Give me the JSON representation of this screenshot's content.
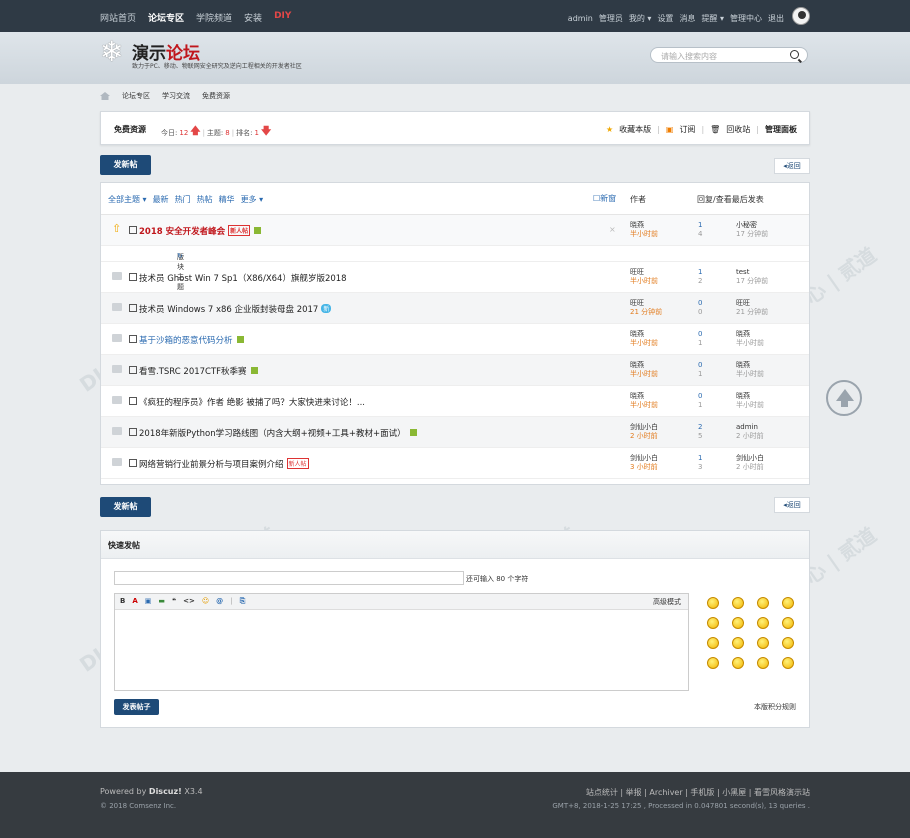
{
  "topnav": {
    "items": [
      "网站首页",
      "论坛专区",
      "学院频道",
      "安装",
      "DIY"
    ],
    "user_items": [
      "admin",
      "管理员",
      "我的 ▾",
      "设置",
      "消息",
      "提醒 ▾",
      "管理中心",
      "退出"
    ]
  },
  "header": {
    "logo_title_a": "演示",
    "logo_title_b": "论坛",
    "logo_subtitle": "致力于PC、移动、物联网安全研究及逆向工程相关的开发者社区",
    "search_placeholder": "请输入搜索内容"
  },
  "breadcrumb": [
    "论坛专区",
    "学习交流",
    "免费资源"
  ],
  "forum": {
    "name": "免费资源",
    "today_label": "今日:",
    "today": "12",
    "topics_label": "主题:",
    "topics": "8",
    "rank_label": "排名:",
    "rank": "1",
    "actions": [
      "收藏本版",
      "订阅",
      "回收站",
      "管理面板"
    ]
  },
  "buttons": {
    "new_post": "发新帖",
    "back": "◂返回",
    "submit": "发表帖子"
  },
  "threadlist": {
    "filters": [
      "全部主题 ▾",
      "最新",
      "热门",
      "热帖",
      "精华",
      "更多 ▾"
    ],
    "new_label": "新窗",
    "col_author": "作者",
    "col_reply": "回复/查看",
    "col_last": "最后发表",
    "section_label": "版块主题",
    "threads": [
      {
        "title": "2018 安全开发者峰会",
        "style": "red",
        "tag": "新人帖",
        "img": true,
        "author": "晓燕",
        "atime": "半小时前",
        "replies": "1",
        "views": "4",
        "last": "小秘密",
        "ltime": "17 分钟前"
      },
      {
        "title": "技术员 Ghost Win 7 Sp1（X86/X64）旗舰岁版2018",
        "style": "",
        "tag": "",
        "img": false,
        "author": "旺旺",
        "atime": "半小时前",
        "replies": "1",
        "views": "2",
        "last": "test",
        "ltime": "17 分钟前"
      },
      {
        "title": "技术员 Windows 7 x86 企业版封装母盘 2017",
        "style": "",
        "tag": "新",
        "img": false,
        "author": "旺旺",
        "atime": "21 分钟前",
        "replies": "0",
        "views": "0",
        "last": "旺旺",
        "ltime": "21 分钟前"
      },
      {
        "title": "基于沙箱的恶意代码分析",
        "style": "blue",
        "tag": "",
        "img": true,
        "author": "晓燕",
        "atime": "半小时前",
        "replies": "0",
        "views": "1",
        "last": "晓燕",
        "ltime": "半小时前"
      },
      {
        "title": "看雪.TSRC 2017CTF秋季赛",
        "style": "",
        "tag": "",
        "img": true,
        "author": "晓燕",
        "atime": "半小时前",
        "replies": "0",
        "views": "1",
        "last": "晓燕",
        "ltime": "半小时前"
      },
      {
        "title": "《疯狂的程序员》作者 绝影 被捕了吗？大家快进来讨论！...",
        "style": "",
        "tag": "",
        "img": false,
        "author": "晓燕",
        "atime": "半小时前",
        "replies": "0",
        "views": "1",
        "last": "晓燕",
        "ltime": "半小时前"
      },
      {
        "title": "2018年新版Python学习路线图（内含大纲+视频+工具+教材+面试）",
        "style": "",
        "tag": "",
        "img": true,
        "author": "剑仙小白",
        "atime": "2 小时前",
        "replies": "2",
        "views": "5",
        "last": "admin",
        "ltime": "2 小时前"
      },
      {
        "title": "网络营销行业前景分析与项目案例介绍",
        "style": "",
        "tag": "新人帖",
        "img": false,
        "author": "剑仙小白",
        "atime": "3 小时前",
        "replies": "1",
        "views": "3",
        "last": "剑仙小白",
        "ltime": "2 小时前"
      }
    ]
  },
  "quickpost": {
    "title": "快速发帖",
    "subject_hint": "还可输入 80 个字符",
    "toolbar": [
      "B",
      "A",
      "▣",
      "▬",
      "❝",
      "<>",
      "☺",
      "@",
      "|",
      "⎘"
    ],
    "advanced": "高级模式",
    "rules": "本版积分规则"
  },
  "watermark": "DISCUZ!应用中心 | 贰道",
  "watermark2": "addon.dismall.com",
  "footer": {
    "powered_prefix": "Powered by ",
    "powered_name": "Discuz!",
    "powered_version": " X3.4",
    "copyright": "© 2018 Comsenz Inc.",
    "links": "站点统计 | 举报 | Archiver | 手机版 | 小黑屋 | 看雪风格演示站",
    "stats": "GMT+8, 2018-1-25 17:25 , Processed in 0.047801 second(s), 13 queries ."
  }
}
